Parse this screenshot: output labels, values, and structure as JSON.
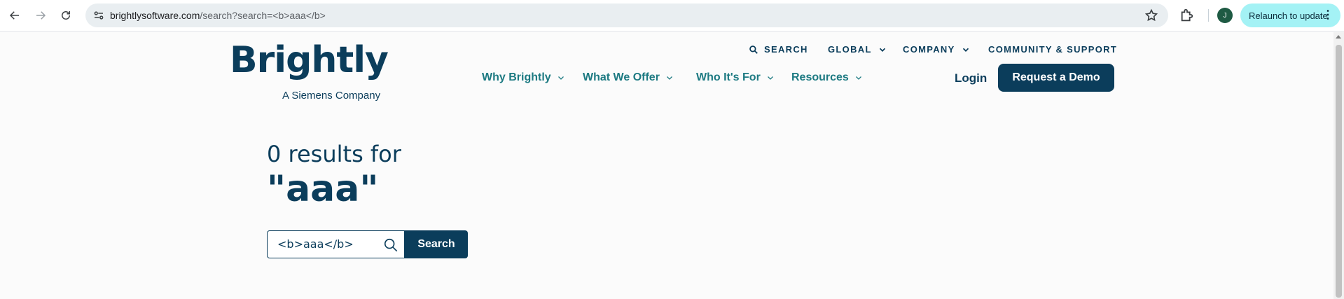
{
  "browser": {
    "url_host": "brightlysoftware.com",
    "url_path": "/search?search=<b>aaa</b>",
    "profile_initial": "J",
    "relaunch_label": "Relaunch to update"
  },
  "site": {
    "logo_text": "Brightly",
    "logo_subtitle": "A Siemens Company",
    "utility_nav": {
      "search": "SEARCH",
      "global": "GLOBAL",
      "company": "COMPANY",
      "community": "COMMUNITY & SUPPORT"
    },
    "main_nav": {
      "why": "Why Brightly",
      "offer": "What We Offer",
      "who": "Who It's For",
      "resources": "Resources"
    },
    "login": "Login",
    "demo": "Request a Demo"
  },
  "results": {
    "count_label": "0 results for",
    "query_display": "\"aaa\"",
    "input_value": "<b>aaa</b>",
    "search_button": "Search"
  }
}
